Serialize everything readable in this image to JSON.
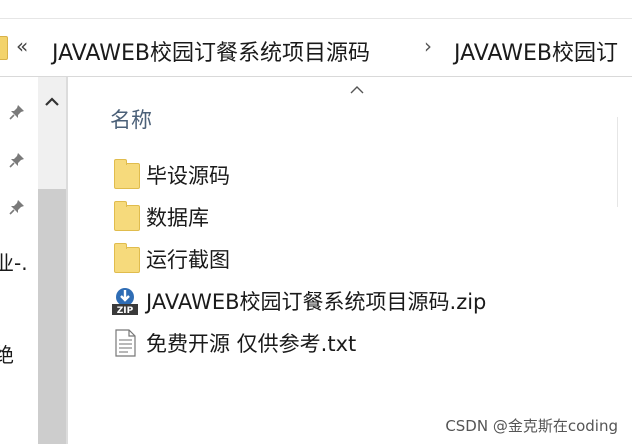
{
  "breadcrumb": {
    "overflow_symbol": "«",
    "separator": "›",
    "items": [
      "JAVAWEB校园订餐系统项目源码",
      "JAVAWEB校园订"
    ]
  },
  "nav": {
    "partial_labels": [
      "业-.",
      "绝"
    ]
  },
  "list": {
    "column_name": "名称",
    "sort_direction": "ascending",
    "items": [
      {
        "name": "毕设源码",
        "type": "folder",
        "icon": "folder-icon"
      },
      {
        "name": "数据库",
        "type": "folder",
        "icon": "folder-icon"
      },
      {
        "name": "运行截图",
        "type": "folder",
        "icon": "folder-icon"
      },
      {
        "name": "JAVAWEB校园订餐系统项目源码.zip",
        "type": "zip",
        "icon": "zip-archive-icon"
      },
      {
        "name": "免费开源 仅供参考.txt",
        "type": "txt",
        "icon": "text-file-icon"
      }
    ]
  },
  "watermark": "CSDN @金克斯在coding",
  "colors": {
    "folder": "#f6da7c",
    "scrollbar_thumb": "#cdcdcd",
    "header_text": "#4b6078"
  }
}
